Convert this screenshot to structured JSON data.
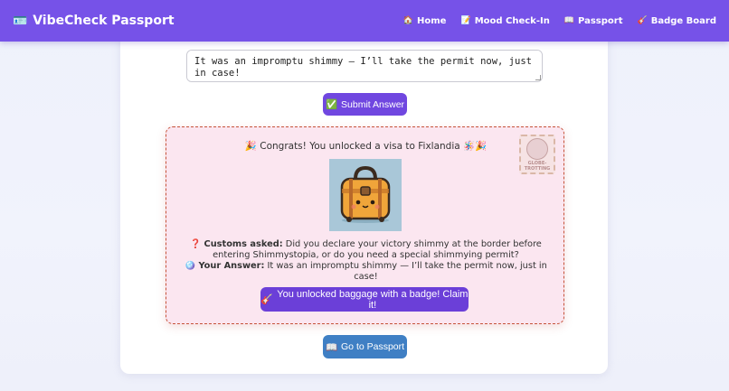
{
  "nav": {
    "brand": "VibeCheck Passport",
    "links": [
      {
        "icon": "🏠",
        "label": "Home"
      },
      {
        "icon": "📝",
        "label": "Mood Check-In"
      },
      {
        "icon": "📖",
        "label": "Passport"
      },
      {
        "icon": "🎸",
        "label": "Badge Board"
      }
    ]
  },
  "answer_input": {
    "value": "It was an impromptu shimmy — I’ll take the permit now, just in case!"
  },
  "submit": {
    "icon": "✅",
    "label": "Submit Answer"
  },
  "visa": {
    "congrats": "🎉 Congrats! You unlocked a visa to Fixlandia 🪅🎉",
    "stamp_text": "GLOBE-TROTTING",
    "customs_label": "Customs asked:",
    "customs_icon": "❓",
    "customs_question": "Did you declare your victory shimmy at the border before entering Shimmystopia, or do you need a special shimmying permit?",
    "answer_icon": "🪩",
    "answer_label": "Your Answer:",
    "answer_text": "It was an impromptu shimmy — I’ll take the permit now, just in case!",
    "claim_icon": "🎸",
    "claim_label": "You unlocked baggage with a badge! Claim it!"
  },
  "go_passport": {
    "icon": "📖",
    "label": "Go to Passport"
  },
  "colors": {
    "nav_bg": "#7652e8",
    "submit_bg": "#7047e0",
    "claim_bg": "#6b3fd8",
    "passport_bg": "#3f7fc4",
    "visa_bg": "#fbe6f0",
    "visa_border": "#c6533a"
  }
}
